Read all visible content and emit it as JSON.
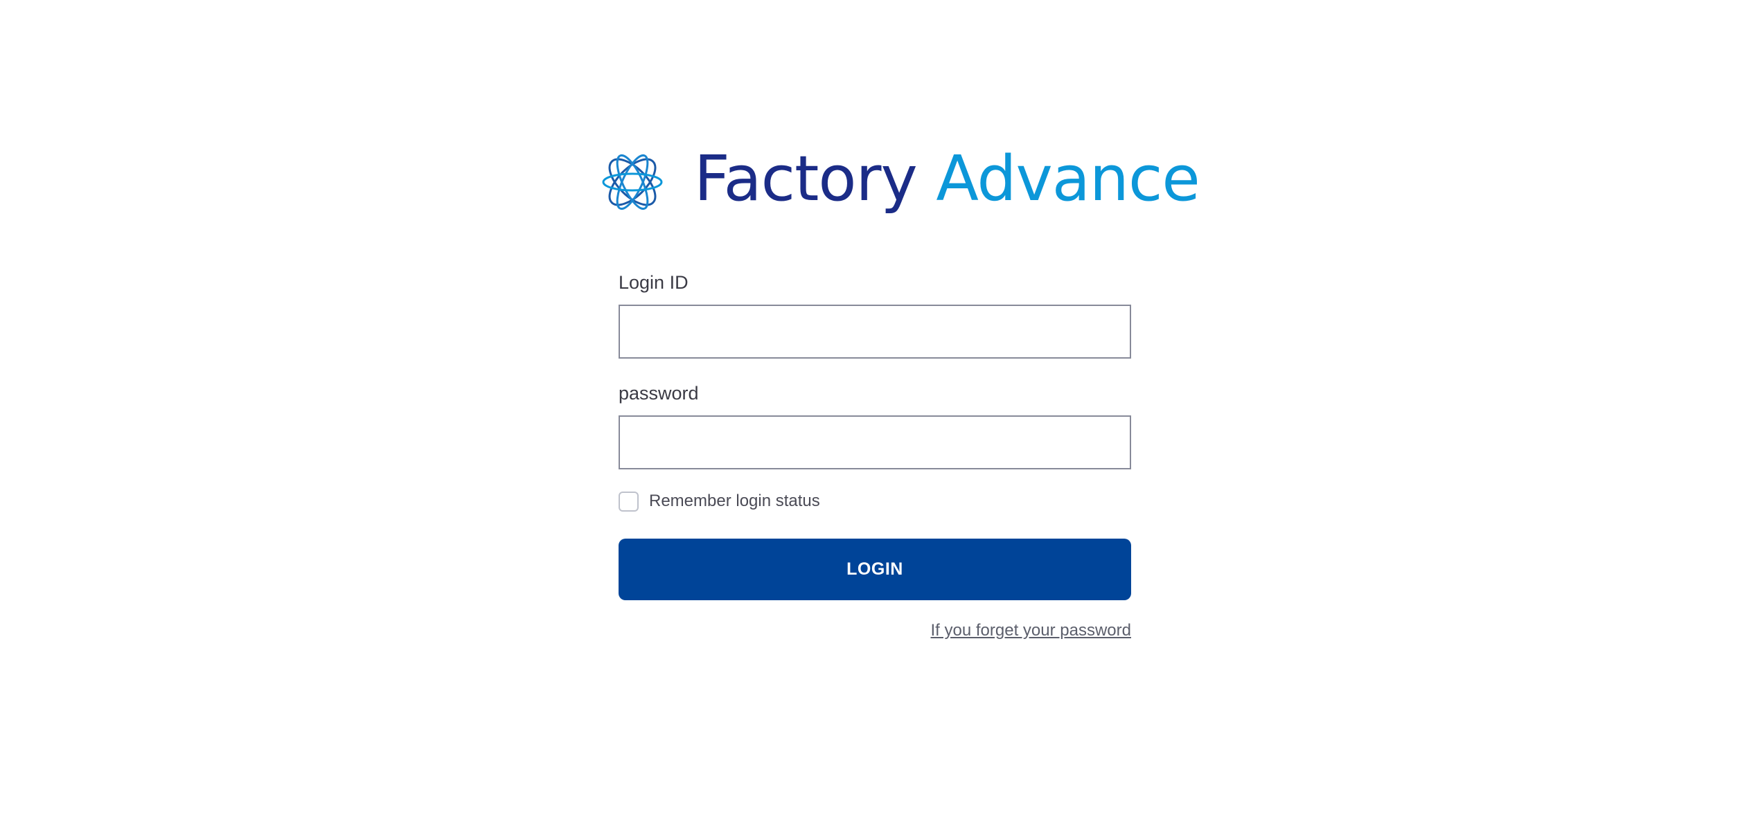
{
  "brand": {
    "name_part1": "Factory",
    "name_part2": "Advance",
    "colors": {
      "dark_blue": "#1b2c87",
      "light_blue": "#0c97d9"
    }
  },
  "form": {
    "login_id_label": "Login ID",
    "login_id_value": "",
    "password_label": "password",
    "password_value": "",
    "remember_label": "Remember login status",
    "remember_checked": false,
    "login_button_label": "LOGIN",
    "forgot_password_link": "If you forget your password"
  },
  "colors": {
    "button_bg": "#004498",
    "button_text": "#ffffff",
    "link": "#5b5e6b"
  }
}
